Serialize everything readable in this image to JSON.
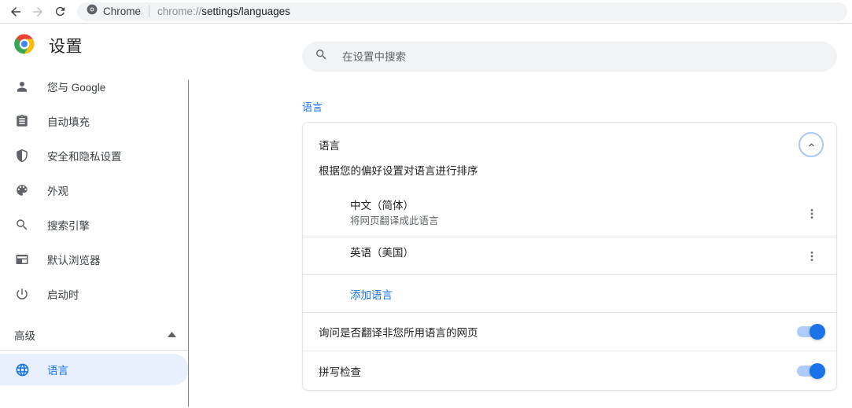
{
  "browser": {
    "back_icon": "arrow-left-icon",
    "forward_icon": "arrow-right-icon",
    "reload_icon": "reload-icon",
    "site_chip_icon": "chrome-favicon-icon",
    "site_chip_label": "Chrome",
    "url_scheme": "chrome://",
    "url_path": "settings/languages"
  },
  "sidebar": {
    "logo_icon": "chrome-logo-icon",
    "title": "设置",
    "items": [
      {
        "label": "您与 Google",
        "icon": "person-icon",
        "selected": false
      },
      {
        "label": "自动填充",
        "icon": "assignment-icon",
        "selected": false
      },
      {
        "label": "安全和隐私设置",
        "icon": "shield-icon",
        "selected": false
      },
      {
        "label": "外观",
        "icon": "palette-icon",
        "selected": false
      },
      {
        "label": "搜索引擎",
        "icon": "search-icon",
        "selected": false
      },
      {
        "label": "默认浏览器",
        "icon": "browser-window-icon",
        "selected": false
      },
      {
        "label": "启动时",
        "icon": "power-icon",
        "selected": false
      }
    ],
    "advanced": {
      "label": "高级",
      "expanded": true,
      "arrow_icon": "triangle-up-icon"
    },
    "advanced_items": [
      {
        "label": "语言",
        "icon": "globe-icon",
        "selected": true
      }
    ],
    "scrollbar_present": true
  },
  "search": {
    "icon": "search-icon",
    "placeholder": "在设置中搜索",
    "value": ""
  },
  "main": {
    "section_title": "语言",
    "card": {
      "header_title": "语言",
      "collapse_icon": "chevron-up-icon",
      "subtitle": "根据您的偏好设置对语言进行排序",
      "languages": [
        {
          "name": "中文（简体）",
          "desc": "将网页翻译成此语言",
          "menu_icon": "more-vert-icon"
        },
        {
          "name": "英语（美国）",
          "desc": "",
          "menu_icon": "more-vert-icon"
        }
      ],
      "add_language_label": "添加语言",
      "toggles": [
        {
          "label": "询问是否翻译非您所用语言的网页",
          "on": true
        },
        {
          "label": "拼写检查",
          "on": true
        }
      ]
    }
  },
  "colors": {
    "accent": "#1a73e8",
    "selected_bg": "#e8f0fe",
    "toggle_track": "#aecbfa",
    "toggle_knob": "#1a73e8",
    "text_primary": "#202124",
    "text_secondary": "#5f6368",
    "field_bg": "#f1f3f4"
  }
}
